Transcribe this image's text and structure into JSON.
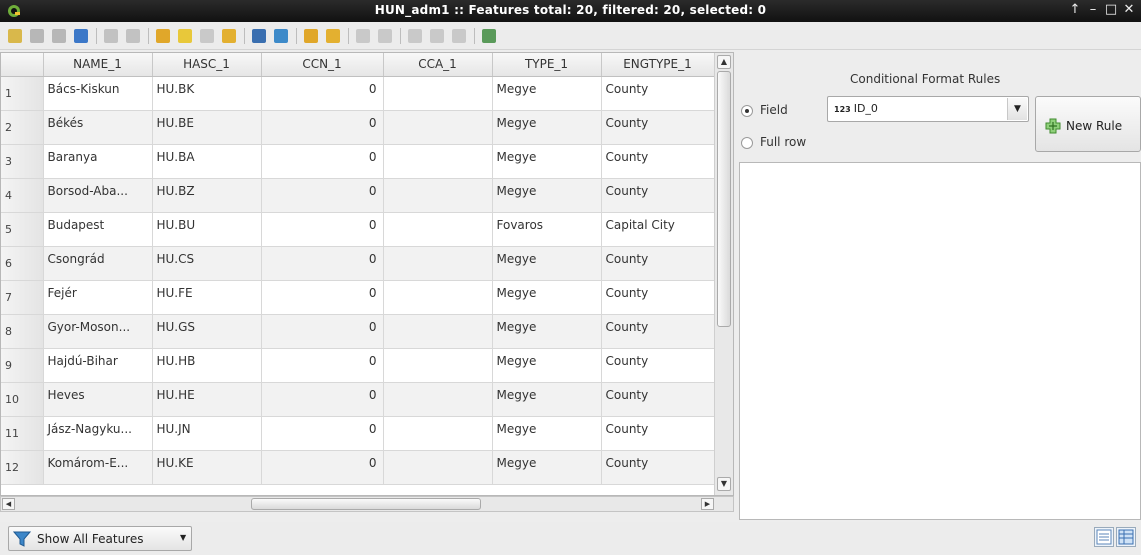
{
  "window": {
    "title": "HUN_adm1 :: Features total: 20, filtered: 20, selected: 0",
    "controls": [
      "↑",
      "–",
      "□",
      "✕"
    ]
  },
  "toolbar": {
    "icons": [
      {
        "name": "toggle-editing-icon",
        "color": "#d9b84b"
      },
      {
        "name": "toggle-multi-edit-icon",
        "color": "#b7b7b7"
      },
      {
        "name": "save-edits-icon",
        "color": "#b7b7b7"
      },
      {
        "name": "reload-icon",
        "color": "#3c78c8"
      },
      {
        "name": "add-feature-icon",
        "color": "#c2c2c2"
      },
      {
        "name": "delete-selected-icon",
        "color": "#c2c2c2"
      },
      {
        "name": "select-by-expression-icon",
        "color": "#e0a72a"
      },
      {
        "name": "select-all-icon",
        "color": "#e8c83a"
      },
      {
        "name": "invert-selection-icon",
        "color": "#c9c9c9"
      },
      {
        "name": "deselect-all-icon",
        "color": "#e3b030"
      },
      {
        "name": "filter-select-icon",
        "color": "#3a6fb0"
      },
      {
        "name": "move-selection-top-icon",
        "color": "#3d8ac9"
      },
      {
        "name": "pan-to-selected-icon",
        "color": "#e0a72a"
      },
      {
        "name": "zoom-to-selected-icon",
        "color": "#e3b030"
      },
      {
        "name": "copy-rows-icon",
        "color": "#c9c9c9"
      },
      {
        "name": "paste-rows-icon",
        "color": "#c9c9c9"
      },
      {
        "name": "new-field-icon",
        "color": "#c9c9c9"
      },
      {
        "name": "delete-field-icon",
        "color": "#c9c9c9"
      },
      {
        "name": "field-calculator-icon",
        "color": "#c9c9c9"
      },
      {
        "name": "conditional-formatting-icon",
        "color": "#5a9a5a"
      }
    ]
  },
  "table": {
    "columns": [
      "NAME_1",
      "HASC_1",
      "CCN_1",
      "CCA_1",
      "TYPE_1",
      "ENGTYPE_1"
    ],
    "rows": [
      {
        "n": "1",
        "name": "Bács-Kiskun",
        "hasc": "HU.BK",
        "ccn": "0",
        "cca": "",
        "type": "Megye",
        "engtype": "County"
      },
      {
        "n": "2",
        "name": "Békés",
        "hasc": "HU.BE",
        "ccn": "0",
        "cca": "",
        "type": "Megye",
        "engtype": "County"
      },
      {
        "n": "3",
        "name": "Baranya",
        "hasc": "HU.BA",
        "ccn": "0",
        "cca": "",
        "type": "Megye",
        "engtype": "County"
      },
      {
        "n": "4",
        "name": "Borsod-Aba...",
        "hasc": "HU.BZ",
        "ccn": "0",
        "cca": "",
        "type": "Megye",
        "engtype": "County"
      },
      {
        "n": "5",
        "name": "Budapest",
        "hasc": "HU.BU",
        "ccn": "0",
        "cca": "",
        "type": "Fovaros",
        "engtype": "Capital City"
      },
      {
        "n": "6",
        "name": "Csongrád",
        "hasc": "HU.CS",
        "ccn": "0",
        "cca": "",
        "type": "Megye",
        "engtype": "County"
      },
      {
        "n": "7",
        "name": "Fejér",
        "hasc": "HU.FE",
        "ccn": "0",
        "cca": "",
        "type": "Megye",
        "engtype": "County"
      },
      {
        "n": "8",
        "name": "Gyor-Moson...",
        "hasc": "HU.GS",
        "ccn": "0",
        "cca": "",
        "type": "Megye",
        "engtype": "County"
      },
      {
        "n": "9",
        "name": "Hajdú-Bihar",
        "hasc": "HU.HB",
        "ccn": "0",
        "cca": "",
        "type": "Megye",
        "engtype": "County"
      },
      {
        "n": "10",
        "name": "Heves",
        "hasc": "HU.HE",
        "ccn": "0",
        "cca": "",
        "type": "Megye",
        "engtype": "County"
      },
      {
        "n": "11",
        "name": "Jász-Nagyku...",
        "hasc": "HU.JN",
        "ccn": "0",
        "cca": "",
        "type": "Megye",
        "engtype": "County"
      },
      {
        "n": "12",
        "name": "Komárom-E...",
        "hasc": "HU.KE",
        "ccn": "0",
        "cca": "",
        "type": "Megye",
        "engtype": "County"
      }
    ]
  },
  "conditional_format": {
    "title": "Conditional Format Rules",
    "field_label": "Field",
    "full_row_label": "Full row",
    "selected_mode": "Field",
    "field_type_badge": "123",
    "field_value": "ID_0",
    "new_rule_label": "New Rule"
  },
  "bottom": {
    "filter_button_label": "Show All Features"
  }
}
